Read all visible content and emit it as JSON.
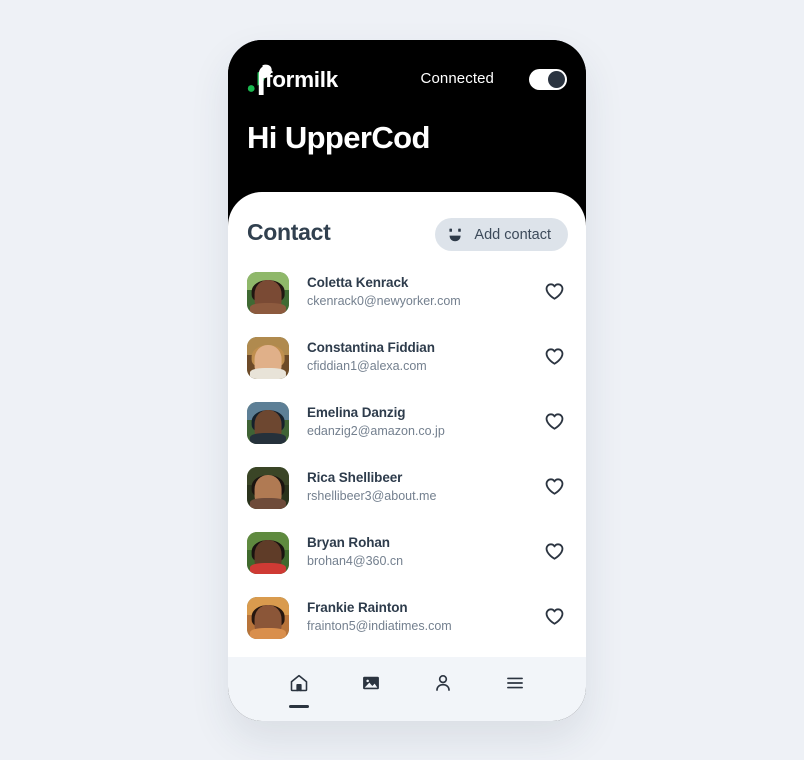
{
  "app": {
    "brand_name": "formilk",
    "brand_accent": "#1ab84f",
    "header_background": "#000000",
    "page_background": "#eef1f6"
  },
  "header": {
    "status_label": "Connected",
    "toggle": {
      "name": "connection-toggle",
      "state": "on"
    },
    "greeting": "Hi UpperCod"
  },
  "contacts_section": {
    "title": "Contact",
    "add_button": {
      "label": "Add contact",
      "icon": "smiley-face-icon",
      "background": "#dde3ea"
    },
    "items": [
      {
        "name": "Coletta Kenrack",
        "email": "ckenrack0@newyorker.com",
        "favorite": false,
        "avatar": {
          "sky": "#8fb86a",
          "ground": "#3f6a33",
          "skin": "#7a4a34",
          "hair": "#201611",
          "body": "#8d5a3e"
        }
      },
      {
        "name": "Constantina Fiddian",
        "email": "cfiddian1@alexa.com",
        "favorite": false,
        "avatar": {
          "sky": "#b08a4e",
          "ground": "#6d4a28",
          "skin": "#e0b089",
          "hair": "#c08f4e",
          "body": "#e8e3d8"
        }
      },
      {
        "name": "Emelina Danzig",
        "email": "edanzig2@amazon.co.jp",
        "favorite": false,
        "avatar": {
          "sky": "#5d7f96",
          "ground": "#3f6335",
          "skin": "#6d4730",
          "hair": "#15202b",
          "body": "#25313b"
        }
      },
      {
        "name": "Rica Shellibeer",
        "email": "rshellibeer3@about.me",
        "favorite": false,
        "avatar": {
          "sky": "#3a4526",
          "ground": "#2a331c",
          "skin": "#b07a53",
          "hair": "#1b1410",
          "body": "#6e4b3a"
        }
      },
      {
        "name": "Bryan Rohan",
        "email": "brohan4@360.cn",
        "favorite": false,
        "avatar": {
          "sky": "#5f8a3f",
          "ground": "#3f6a2d",
          "skin": "#5f3c28",
          "hair": "#191310",
          "body": "#cf3a34"
        }
      },
      {
        "name": "Frankie Rainton",
        "email": "frainton5@indiatimes.com",
        "favorite": false,
        "avatar": {
          "sky": "#d99b4e",
          "ground": "#b8743a",
          "skin": "#8b5638",
          "hair": "#26170f",
          "body": "#d98f4d"
        }
      }
    ],
    "favorite_icon": "heart-outline-icon"
  },
  "bottom_nav": {
    "background": "#f2f5f9",
    "items": [
      {
        "icon": "home-icon",
        "active": true
      },
      {
        "icon": "image-icon",
        "active": false
      },
      {
        "icon": "person-icon",
        "active": false
      },
      {
        "icon": "menu-icon",
        "active": false
      }
    ]
  }
}
